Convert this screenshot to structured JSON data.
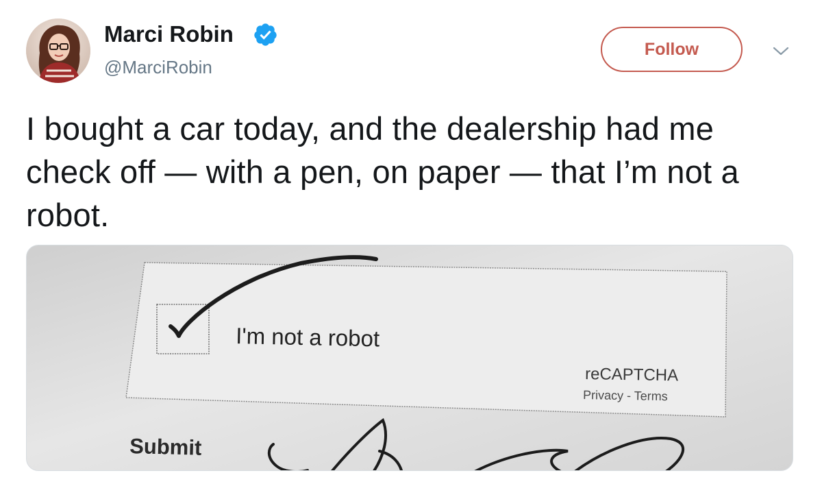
{
  "tweet": {
    "author": {
      "display_name": "Marci Robin",
      "handle": "@MarciRobin",
      "verified": true,
      "avatar_icon": "avatar-photo"
    },
    "follow_label": "Follow",
    "text": "I bought a car today, and the dealership had me check off — with a pen, on paper — that I’m not a robot.",
    "media": {
      "checkbox_label": "I'm not a robot",
      "brand": "reCAPTCHA",
      "links": "Privacy - Terms",
      "submit_label": "Submit"
    }
  },
  "colors": {
    "follow_accent": "#c45a4f",
    "verified_blue": "#1da1f2",
    "handle_gray": "#657786",
    "text": "#14171a"
  },
  "icons": {
    "verified": "verified-badge-icon",
    "menu": "chevron-down-icon"
  }
}
